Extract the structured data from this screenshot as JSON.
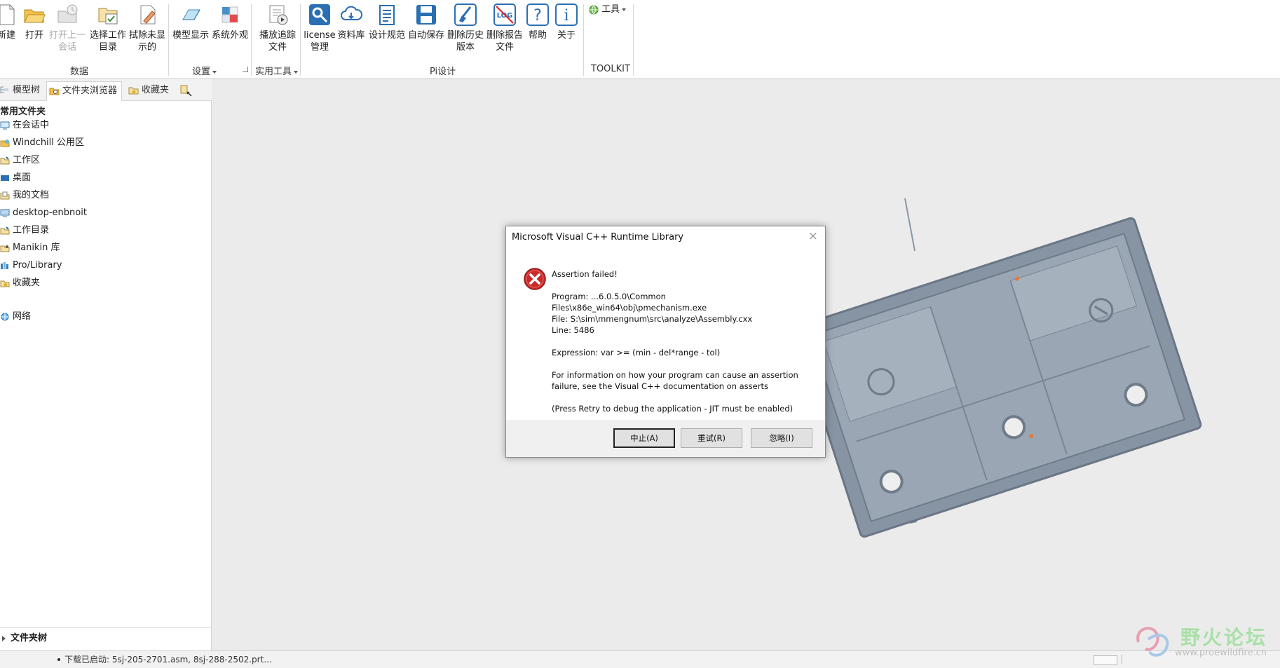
{
  "ribbon": {
    "buttons": [
      {
        "label": "新建",
        "icon": "new-file-icon",
        "disabled": false
      },
      {
        "label": "打开",
        "icon": "open-folder-icon",
        "disabled": false
      },
      {
        "label": "打开上一\n会话",
        "icon": "open-last-session-icon",
        "disabled": true
      },
      {
        "label": "选择工作\n目录",
        "icon": "select-working-dir-icon",
        "disabled": false
      },
      {
        "label": "拭除未显\n示的",
        "icon": "erase-not-displayed-icon",
        "disabled": false
      },
      {
        "label": "模型显示",
        "icon": "model-display-icon",
        "disabled": false
      },
      {
        "label": "系统外观",
        "icon": "system-appearance-icon",
        "disabled": false
      },
      {
        "label": "播放追踪\n文件",
        "icon": "play-trail-file-icon",
        "disabled": false
      },
      {
        "label": "license\n管理",
        "icon": "license-manage-icon",
        "disabled": false
      },
      {
        "label": "资料库",
        "icon": "library-cloud-icon",
        "disabled": false
      },
      {
        "label": "设计规范",
        "icon": "design-spec-icon",
        "disabled": false
      },
      {
        "label": "自动保存",
        "icon": "auto-save-icon",
        "disabled": false
      },
      {
        "label": "删除历史\n版本",
        "icon": "delete-old-versions-icon",
        "disabled": false
      },
      {
        "label": "删除报告\n文件",
        "icon": "delete-log-files-icon",
        "disabled": false
      },
      {
        "label": "帮助",
        "icon": "help-icon",
        "disabled": false
      },
      {
        "label": "关于",
        "icon": "about-icon",
        "disabled": false
      }
    ],
    "tools_dropdown": "工具",
    "groups": {
      "data": "数据",
      "settings": "设置",
      "utilities": "实用工具",
      "pi_design": "Pi设计",
      "toolkit": "TOOLKIT"
    }
  },
  "left_panel": {
    "tabs": [
      {
        "label": "模型树",
        "icon": "model-tree-icon"
      },
      {
        "label": "文件夹浏览器",
        "icon": "folder-browser-icon"
      },
      {
        "label": "收藏夹",
        "icon": "favorites-icon"
      }
    ],
    "section_title": "常用文件夹",
    "items": [
      {
        "label": "在会话中",
        "icon": "in-session-icon"
      },
      {
        "label": "Windchill 公用区",
        "icon": "windchill-icon"
      },
      {
        "label": "工作区",
        "icon": "workspace-icon"
      },
      {
        "label": "桌面",
        "icon": "desktop-icon"
      },
      {
        "label": "我的文档",
        "icon": "my-documents-icon"
      },
      {
        "label": "desktop-enbnoit",
        "icon": "computer-icon"
      },
      {
        "label": "工作目录",
        "icon": "working-directory-icon"
      },
      {
        "label": "Manikin 库",
        "icon": "manikin-library-icon"
      },
      {
        "label": "Pro/Library",
        "icon": "pro-library-icon"
      },
      {
        "label": "收藏夹",
        "icon": "favorites-folder-icon"
      },
      {
        "label": "网络",
        "icon": "network-icon"
      }
    ],
    "bottom_title": "文件夹树"
  },
  "status_bar": {
    "message": "下载已启动: 5sj-205-2701.asm, 8sj-288-2502.prt..."
  },
  "dialog": {
    "title": "Microsoft Visual C++ Runtime Library",
    "close": "×",
    "lines": {
      "heading": "Assertion failed!",
      "program": "Program: ...6.0.5.0\\Common Files\\x86e_win64\\obj\\pmechanism.exe",
      "file": "File: S:\\sim\\mmengnum\\src\\analyze\\Assembly.cxx",
      "line": "Line: 5486",
      "expression": "Expression: var >= (min - del*range - tol)",
      "info1": "For information on how your program can cause an assertion",
      "info2": "failure, see the Visual C++ documentation on asserts",
      "retry_note": "(Press Retry to debug the application - JIT must be enabled)"
    },
    "buttons": {
      "abort": "中止(A)",
      "retry": "重试(R)",
      "ignore": "忽略(I)"
    }
  },
  "watermark": {
    "title": "野火论坛",
    "url": "www.proewildfire.cn"
  }
}
